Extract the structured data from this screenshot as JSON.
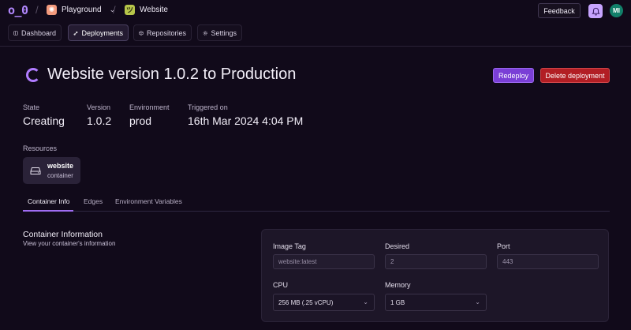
{
  "app": {
    "logo": "o_0"
  },
  "breadcrumb": {
    "project": "Playground",
    "project_icon": "sparkle-icon",
    "app": "Website",
    "app_icon": "smile-face-icon"
  },
  "header": {
    "feedback_label": "Feedback",
    "avatar_initials": "MI"
  },
  "nav": {
    "items": [
      {
        "label": "Dashboard",
        "icon": "dashboard-icon"
      },
      {
        "label": "Deployments",
        "icon": "deployments-icon",
        "active": true
      },
      {
        "label": "Repositories",
        "icon": "box-icon"
      },
      {
        "label": "Settings",
        "icon": "gear-icon"
      }
    ]
  },
  "deployment": {
    "title": "Website version 1.0.2 to Production",
    "redeploy_label": "Redeploy",
    "delete_label": "Delete deployment",
    "stats": [
      {
        "label": "State",
        "value": "Creating"
      },
      {
        "label": "Version",
        "value": "1.0.2"
      },
      {
        "label": "Environment",
        "value": "prod"
      },
      {
        "label": "Triggered on",
        "value": "16th Mar 2024 4:04 PM"
      }
    ]
  },
  "resources": {
    "label": "Resources",
    "items": [
      {
        "name": "website",
        "type": "container"
      }
    ]
  },
  "tabs": [
    {
      "label": "Container Info",
      "active": true
    },
    {
      "label": "Edges"
    },
    {
      "label": "Environment Variables"
    }
  ],
  "container_info": {
    "title": "Container Information",
    "subtitle": "View your container's information",
    "fields": {
      "image_tag": {
        "label": "Image Tag",
        "value": "website:latest"
      },
      "desired": {
        "label": "Desired",
        "value": "2"
      },
      "port": {
        "label": "Port",
        "value": "443"
      },
      "cpu": {
        "label": "CPU",
        "value": "256 MB (.25 vCPU)"
      },
      "memory": {
        "label": "Memory",
        "value": "1 GB"
      }
    }
  },
  "colors": {
    "background": "#110a1a",
    "accent": "#b07cff",
    "redeploy": "#7a3fd6",
    "danger": "#b21e24"
  }
}
